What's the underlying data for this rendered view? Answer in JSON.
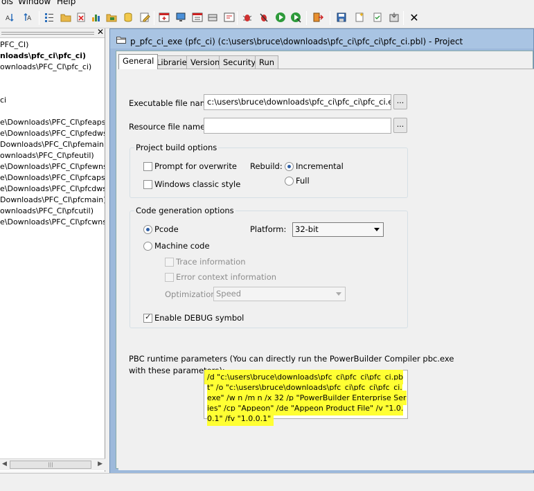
{
  "menubar": {
    "items": [
      "ols",
      "Window",
      "Help"
    ]
  },
  "toolbar": {
    "close_label": "✕"
  },
  "left_pane": {
    "tree_items": [
      {
        "label": "PFC_CI)",
        "bold": false
      },
      {
        "label": "nloads\\pfc_ci\\pfc_ci)",
        "bold": true
      },
      {
        "label": "ownloads\\PFC_CI\\pfc_ci)",
        "bold": false
      },
      {
        "label": "ci",
        "bold": false
      },
      {
        "label": "e\\Downloads\\PFC_CI\\pfeapsrv)",
        "bold": false
      },
      {
        "label": "e\\Downloads\\PFC_CI\\pfedwsrv",
        "bold": false
      },
      {
        "label": "Downloads\\PFC_CI\\pfemain)",
        "bold": false
      },
      {
        "label": "ownloads\\PFC_CI\\pfeutil)",
        "bold": false
      },
      {
        "label": "e\\Downloads\\PFC_CI\\pfewnsrv",
        "bold": false
      },
      {
        "label": "e\\Downloads\\PFC_CI\\pfcapsrv)",
        "bold": false
      },
      {
        "label": "e\\Downloads\\PFC_CI\\pfcdwsrv",
        "bold": false
      },
      {
        "label": "Downloads\\PFC_CI\\pfcmain)",
        "bold": false
      },
      {
        "label": "ownloads\\PFC_CI\\pfcutil)",
        "bold": false
      },
      {
        "label": "e\\Downloads\\PFC_CI\\pfcwnsrv",
        "bold": false
      }
    ],
    "scroll_thumb_grip": "|||"
  },
  "window": {
    "title": "p_pfc_ci_exe (pfc_ci) (c:\\users\\bruce\\downloads\\pfc_ci\\pfc_ci\\pfc_ci.pbl) - Project"
  },
  "tabs": [
    "General",
    "Libraries",
    "Version",
    "Security",
    "Run"
  ],
  "general": {
    "exe_label": "Executable file name:",
    "exe_value": "c:\\users\\bruce\\downloads\\pfc_ci\\pfc_ci\\pfc_ci.exe",
    "res_label": "Resource file name:",
    "res_value": "",
    "browse_label": "...",
    "build_group": "Project build options",
    "prompt_overwrite": "Prompt for overwrite",
    "windows_classic": "Windows classic style",
    "rebuild_label": "Rebuild:",
    "incremental": "Incremental",
    "full": "Full",
    "codegen_group": "Code generation options",
    "pcode": "Pcode",
    "machine_code": "Machine code",
    "platform_label": "Platform:",
    "platform_value": "32-bit",
    "trace_info": "Trace information",
    "error_context": "Error context information",
    "optimization_label": "Optimization:",
    "optimization_value": "Speed",
    "enable_debug": "Enable DEBUG symbol",
    "pbc_label_line1": "PBC runtime parameters (You can directly run the PowerBuilder Compiler pbc.exe",
    "pbc_label_line2": "with these parameters):",
    "pbc_params": "/d \"c:\\users\\bruce\\downloads\\pfc_ci\\pfc_ci\\pfc_ci.pbt\" /o \"c:\\users\\bruce\\downloads\\pfc_ci\\pfc_ci\\pfc_ci.exe\" /w n /m n /x 32 /p \"PowerBuilder Enterprise Series\" /cp \"Appeon\" /de \"Appeon Product File\" /v \"1.0.0.1\" /fv \"1.0.0.1\""
  },
  "state": {
    "prompt_overwrite_checked": false,
    "windows_classic_checked": false,
    "rebuild": "Incremental",
    "code_type": "Pcode",
    "trace_checked": false,
    "error_context_checked": false,
    "debug_checked": true
  },
  "colors": {
    "highlight": "#ffff33",
    "window_frame": "#9db9db"
  }
}
